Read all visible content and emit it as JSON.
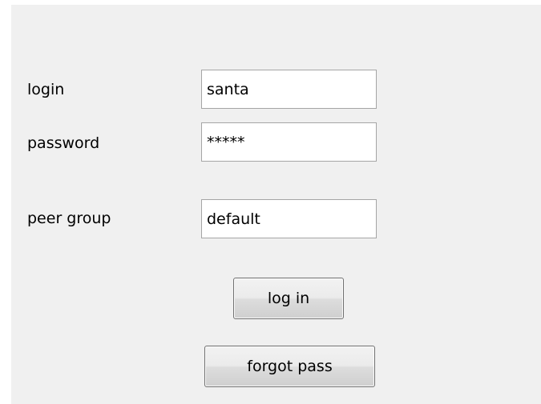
{
  "form": {
    "login_label": "login",
    "login_value": "santa",
    "password_label": "password",
    "password_value": "*****",
    "peer_group_label": "peer group",
    "peer_group_value": "default",
    "login_button": "log in",
    "forgot_button": "forgot pass"
  },
  "colors": {
    "panel_background": "#f0f0f0",
    "field_border": "#a5a5a5",
    "button_border": "#707070"
  }
}
